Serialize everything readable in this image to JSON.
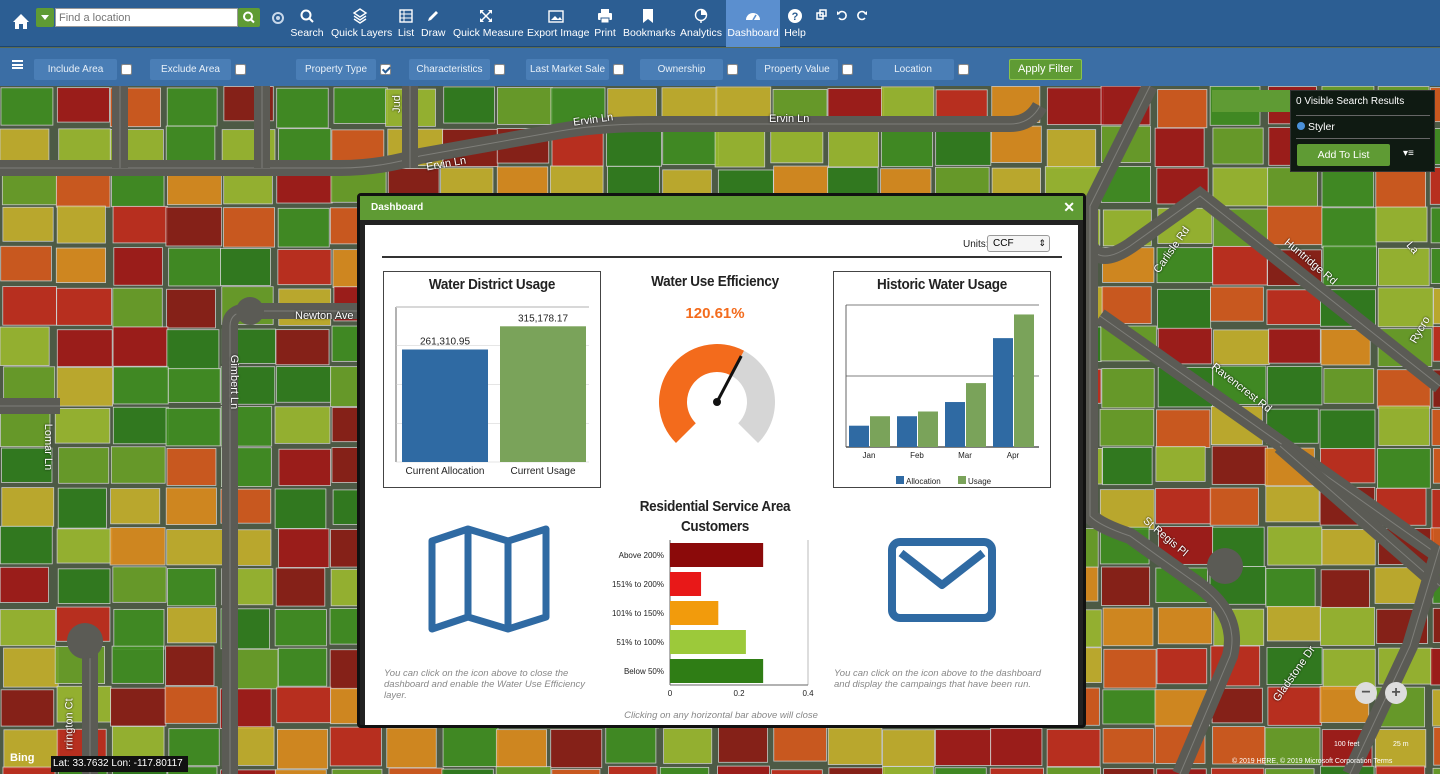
{
  "toolbar": {
    "search_placeholder": "Find a location",
    "tools": [
      {
        "label": "Search",
        "icon": "search-icon"
      },
      {
        "label": "Quick Layers",
        "icon": "layers-icon"
      },
      {
        "label": "List",
        "icon": "list-icon"
      },
      {
        "label": "Draw",
        "icon": "pencil-icon"
      },
      {
        "label": "Quick Measure",
        "icon": "measure-icon"
      },
      {
        "label": "Export Image",
        "icon": "image-icon"
      },
      {
        "label": "Print",
        "icon": "print-icon"
      },
      {
        "label": "Bookmarks",
        "icon": "bookmark-icon"
      },
      {
        "label": "Analytics",
        "icon": "analytics-icon"
      },
      {
        "label": "Dashboard",
        "icon": "dashboard-icon",
        "active": true
      },
      {
        "label": "Help",
        "icon": "help-icon"
      }
    ]
  },
  "filters": {
    "items": [
      {
        "label": "Include Area",
        "checked": false
      },
      {
        "label": "Exclude Area",
        "checked": false
      },
      {
        "label": "Property Type",
        "checked": true
      },
      {
        "label": "Characteristics",
        "checked": false
      },
      {
        "label": "Last Market Sale",
        "checked": false
      },
      {
        "label": "Ownership",
        "checked": false
      },
      {
        "label": "Property Value",
        "checked": false
      },
      {
        "label": "Location",
        "checked": false
      }
    ],
    "apply_label": "Apply Filter"
  },
  "map": {
    "streets": [
      "Ervin Ln",
      "Ervin Ln",
      "Ervin Ln",
      "Newton Ave",
      "Gimbert Ln",
      "Lomar Ln",
      "Carlisle Rd",
      "Huntridge Rd",
      "Ravencrest Rd",
      "St Regis Pl",
      "Gladstone Dr",
      "Jud",
      "La",
      "Rycro",
      "rrington Ct"
    ],
    "lat_lon": "Lat: 33.7632 Lon: -117.80117",
    "bing": "Bing",
    "copyright": "© 2019 HERE, © 2019 Microsoft Corporation",
    "terms": "Terms",
    "scale_feet": "100 feet",
    "scale_m": "25 m"
  },
  "results_panel": {
    "count_text": "0 Visible Search Results",
    "styler": "Styler",
    "add_to_list": "Add To List"
  },
  "dashboard": {
    "title": "Dashboard",
    "units_label": "Units:",
    "units_value": "CCF",
    "district": {
      "title": "Water District Usage",
      "chart_data": {
        "type": "bar",
        "categories": [
          "Current Allocation",
          "Current Usage"
        ],
        "values": [
          261310.95,
          315178.17
        ],
        "labels": [
          "261,310.95",
          "315,178.17"
        ],
        "colors": [
          "#2f6aa3",
          "#7aa35a"
        ]
      }
    },
    "efficiency": {
      "title": "Water Use Efficiency",
      "value_text": "120.61%",
      "value": 120.61
    },
    "historic": {
      "title": "Historic Water Usage",
      "chart_data": {
        "type": "bar",
        "categories": [
          "Jan",
          "Feb",
          "Mar",
          "Apr"
        ],
        "series": [
          {
            "name": "Allocation",
            "values": [
              18,
              26,
              38,
              92
            ],
            "color": "#2f6aa3"
          },
          {
            "name": "Usage",
            "values": [
              26,
              30,
              54,
              112
            ],
            "color": "#7aa35a"
          }
        ],
        "ylim": [
          0,
          120
        ]
      }
    },
    "residential": {
      "title_line1": "Residential Service Area",
      "title_line2": "Customers",
      "chart_data": {
        "type": "bar",
        "orientation": "horizontal",
        "categories": [
          "Above 200%",
          "151% to 200%",
          "101% to 150%",
          "51% to 100%",
          "Below 50%"
        ],
        "values": [
          0.27,
          0.09,
          0.14,
          0.22,
          0.27
        ],
        "colors": [
          "#8b0a0a",
          "#e81818",
          "#f29b0c",
          "#9cc93a",
          "#2f7d15"
        ],
        "xlim": [
          0,
          0.4
        ],
        "ticks": [
          "0",
          "0.2",
          "0.4"
        ]
      },
      "note": "Clicking on any horizontal bar above will close"
    },
    "map_note": "You can click on the icon above to close the dashboard and enable the Water Use Efficiency layer.",
    "mail_note": "You can click on the icon above to the dashboard and display the campaings that have been run."
  }
}
